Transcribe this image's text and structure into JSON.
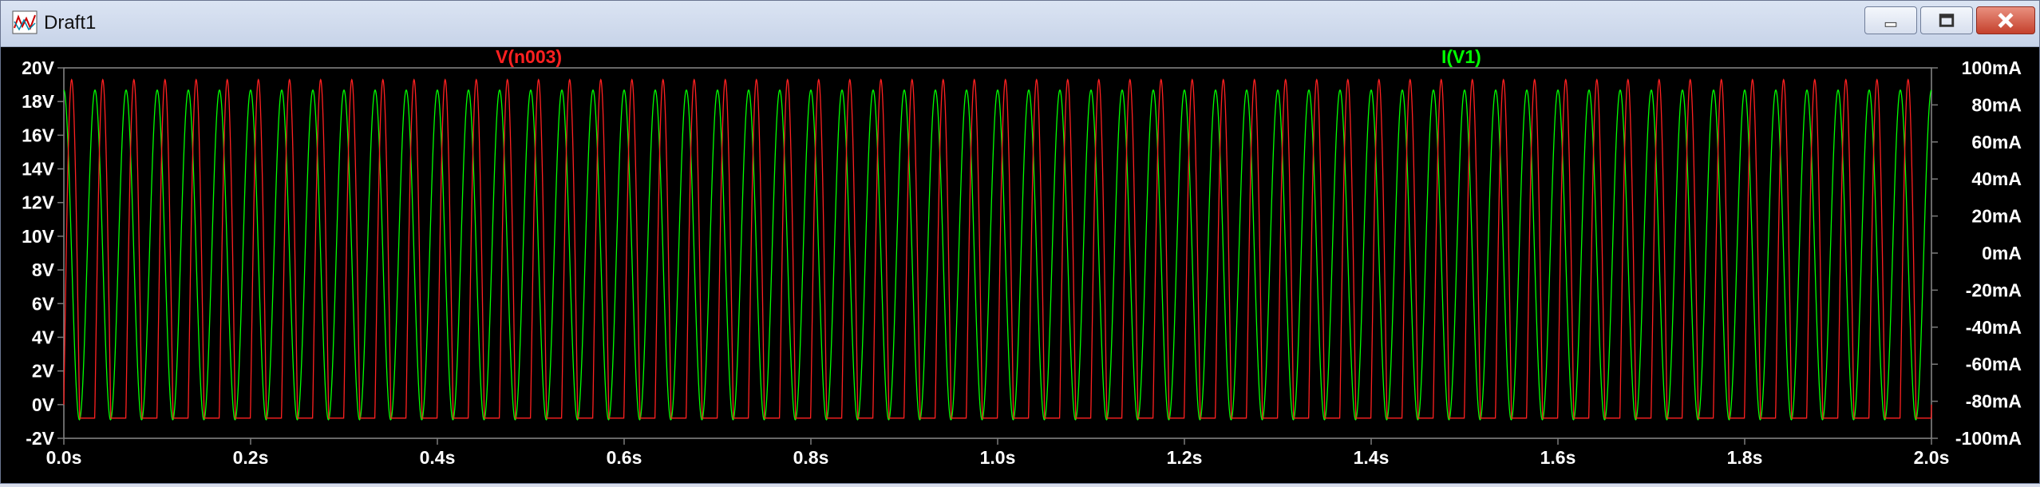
{
  "window": {
    "title": "Draft1"
  },
  "icons": {
    "app": "waveform-app-icon",
    "minimize": "minimize-icon",
    "maximize": "maximize-icon",
    "close": "close-icon"
  },
  "colors": {
    "voltage": "#ff2020",
    "current": "#00ff00",
    "background": "#000000",
    "grid": "#7a7a7a",
    "axis_text": "#ffffff"
  },
  "chart_data": {
    "type": "line",
    "x": {
      "min": 0.0,
      "max": 2.0,
      "ticks": [
        "0.0s",
        "0.2s",
        "0.4s",
        "0.6s",
        "0.8s",
        "1.0s",
        "1.2s",
        "1.4s",
        "1.6s",
        "1.8s",
        "2.0s"
      ]
    },
    "y_left": {
      "min": -2,
      "max": 20,
      "ticks": [
        "20V",
        "18V",
        "16V",
        "14V",
        "12V",
        "10V",
        "8V",
        "6V",
        "4V",
        "2V",
        "0V",
        "-2V"
      ]
    },
    "y_right": {
      "min": -100,
      "max": 100,
      "ticks": [
        "100mA",
        "80mA",
        "60mA",
        "40mA",
        "20mA",
        "0mA",
        "-20mA",
        "-40mA",
        "-60mA",
        "-80mA",
        "-100mA"
      ]
    },
    "grid": false,
    "series": [
      {
        "name": "V(n003)",
        "axis": "left",
        "frequency_hz": 30,
        "peak": 19.3,
        "floor": -0.8,
        "shape": "half-wave rectified sine, clipped flat at floor",
        "phase": 0
      },
      {
        "name": "I(V1)",
        "axis": "right",
        "frequency_hz": 30,
        "peak": 88,
        "trough": -90,
        "shape": "sine, 90 degrees offset from V(n003)",
        "phase": 0.25
      }
    ]
  }
}
